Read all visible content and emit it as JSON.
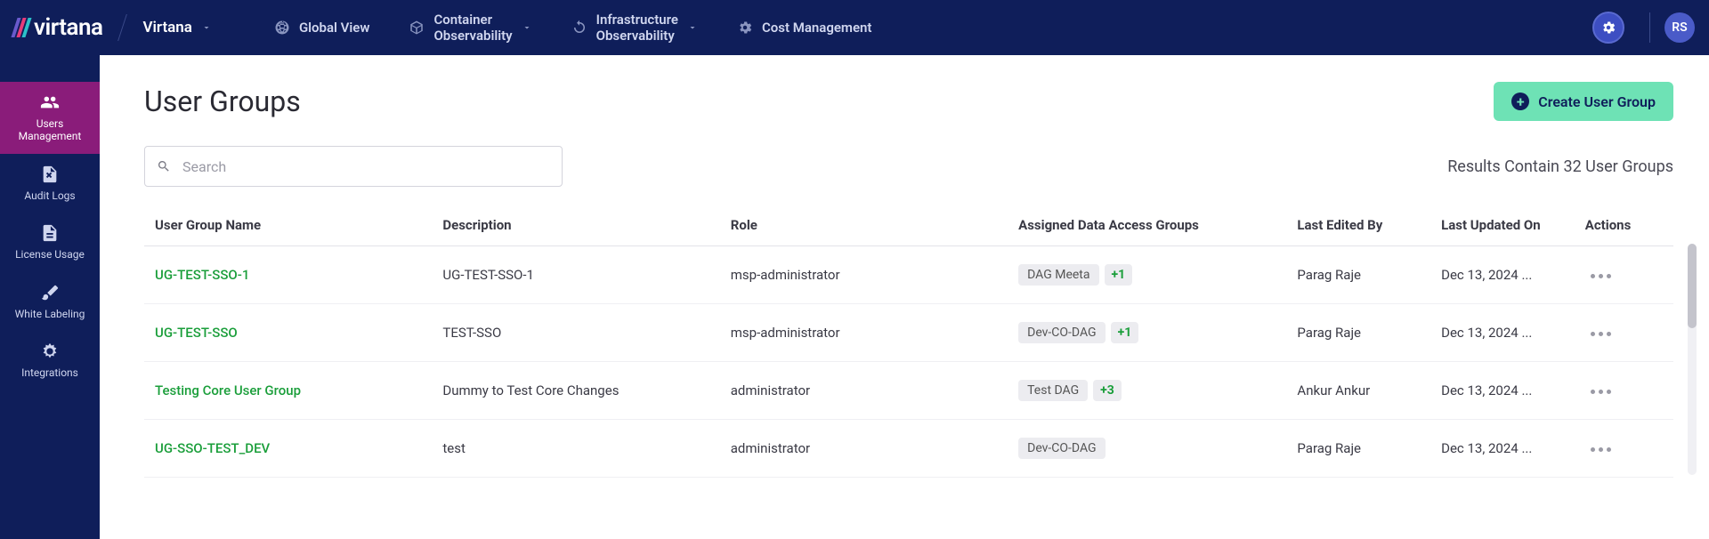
{
  "brand": "virtana",
  "org": "Virtana",
  "nav": {
    "global": "Global View",
    "container": "Container\nObservability",
    "infra": "Infrastructure\nObservability",
    "cost": "Cost Management"
  },
  "avatar": "RS",
  "sidebar": [
    {
      "key": "users",
      "label": "Users\nManagement"
    },
    {
      "key": "audit",
      "label": "Audit Logs"
    },
    {
      "key": "license",
      "label": "License Usage"
    },
    {
      "key": "white",
      "label": "White Labeling"
    },
    {
      "key": "integ",
      "label": "Integrations"
    }
  ],
  "page": {
    "title": "User Groups",
    "create_label": "Create User Group",
    "search_placeholder": "Search",
    "results_text": "Results Contain 32 User Groups"
  },
  "columns": {
    "name": "User Group Name",
    "desc": "Description",
    "role": "Role",
    "dag": "Assigned Data Access Groups",
    "editedby": "Last Edited By",
    "updated": "Last Updated On",
    "actions": "Actions"
  },
  "rows": [
    {
      "name": "UG-TEST-SSO-1",
      "desc": "UG-TEST-SSO-1",
      "role": "msp-administrator",
      "tag": "DAG Meeta",
      "plus": "+1",
      "editedby": "Parag Raje",
      "updated": "Dec 13, 2024 ..."
    },
    {
      "name": "UG-TEST-SSO",
      "desc": "TEST-SSO",
      "role": "msp-administrator",
      "tag": "Dev-CO-DAG",
      "plus": "+1",
      "editedby": "Parag Raje",
      "updated": "Dec 13, 2024 ..."
    },
    {
      "name": "Testing Core User Group",
      "desc": "Dummy to Test Core Changes",
      "role": "administrator",
      "tag": "Test DAG",
      "plus": "+3",
      "editedby": "Ankur Ankur",
      "updated": "Dec 13, 2024 ..."
    },
    {
      "name": "UG-SSO-TEST_DEV",
      "desc": "test",
      "role": "administrator",
      "tag": "Dev-CO-DAG",
      "plus": "",
      "editedby": "Parag Raje",
      "updated": "Dec 13, 2024 ..."
    }
  ]
}
